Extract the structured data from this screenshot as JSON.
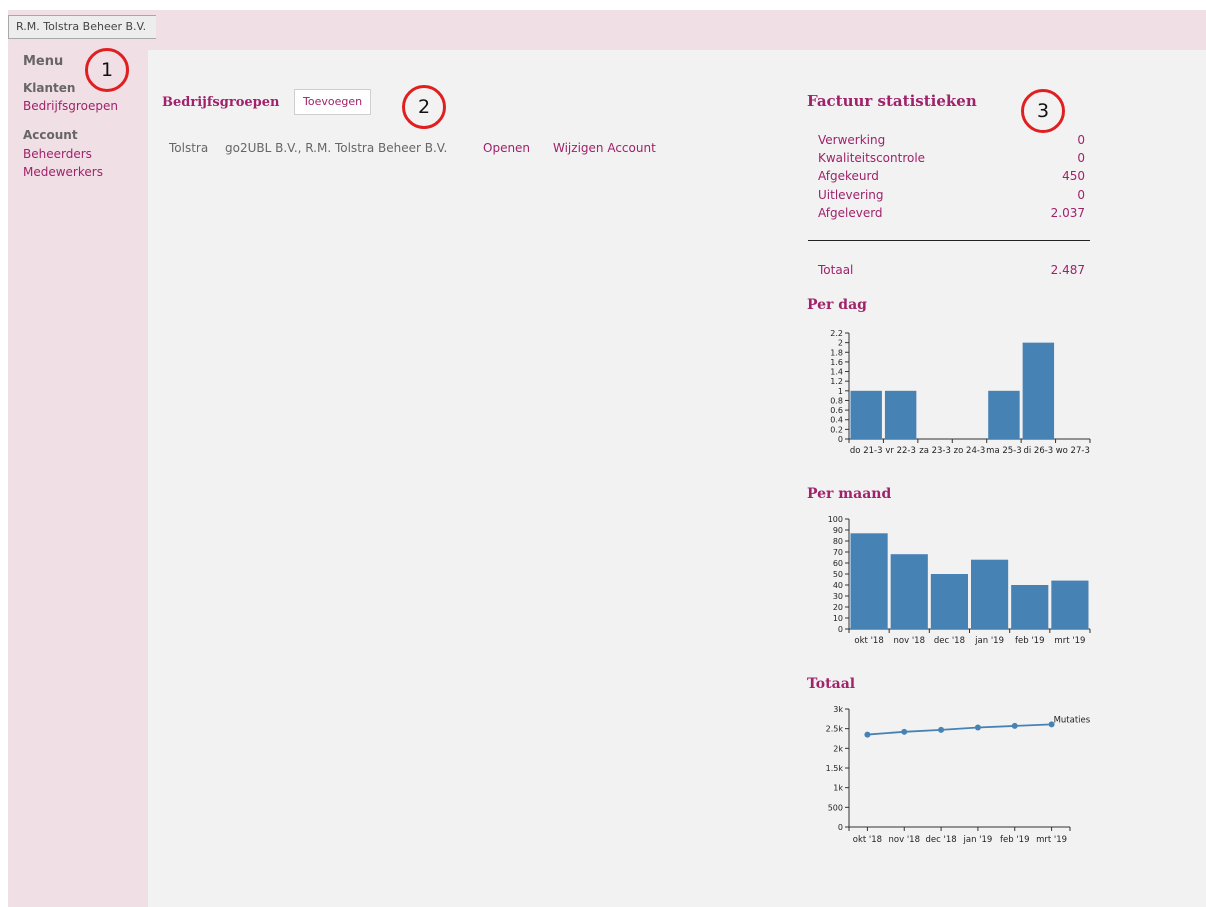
{
  "breadcrumb": {
    "label": "R.M. Tolstra Beheer B.V."
  },
  "sidebar": {
    "menu_label": "Menu",
    "groups": [
      {
        "heading": "Klanten",
        "items": [
          "Bedrijfsgroepen"
        ]
      },
      {
        "heading": "Account",
        "items": [
          "Beheerders",
          "Medewerkers"
        ]
      }
    ]
  },
  "annotations": [
    "1",
    "2",
    "3"
  ],
  "groups_section": {
    "title": "Bedrijfsgroepen",
    "add_button": "Toevoegen",
    "rows": [
      {
        "name": "Tolstra",
        "companies": "go2UBL B.V., R.M. Tolstra Beheer B.V.",
        "open": "Openen",
        "edit": "Wijzigen Account"
      }
    ]
  },
  "stats": {
    "title": "Factuur statistieken",
    "rows": [
      {
        "label": "Verwerking",
        "value": "0"
      },
      {
        "label": "Kwaliteitscontrole",
        "value": "0"
      },
      {
        "label": "Afgekeurd",
        "value": "450"
      },
      {
        "label": "Uitlevering",
        "value": "0"
      },
      {
        "label": "Afgeleverd",
        "value": "2.037"
      }
    ],
    "total_label": "Totaal",
    "total_value": "2.487"
  },
  "colors": {
    "accent": "#a0226a",
    "bar": "#4682b4",
    "sidebar_bg": "#f1dfe6",
    "main_bg": "#f2f2f2"
  },
  "chart_data": [
    {
      "type": "bar",
      "title": "Per dag",
      "categories": [
        "do 21-3",
        "vr 22-3",
        "za 23-3",
        "zo 24-3",
        "ma 25-3",
        "di 26-3",
        "wo 27-3"
      ],
      "values": [
        1,
        1,
        0,
        0,
        1,
        2,
        0
      ],
      "yticks": [
        "0",
        "0.2",
        "0.4",
        "0.6",
        "0.8",
        "1",
        "1.2",
        "1.4",
        "1.6",
        "1.8",
        "2",
        "2.2"
      ],
      "ylim": [
        0,
        2.2
      ]
    },
    {
      "type": "bar",
      "title": "Per maand",
      "categories": [
        "okt '18",
        "nov '18",
        "dec '18",
        "jan '19",
        "feb '19",
        "mrt '19"
      ],
      "values": [
        87,
        68,
        50,
        63,
        40,
        44
      ],
      "yticks": [
        "0",
        "10",
        "20",
        "30",
        "40",
        "50",
        "60",
        "70",
        "80",
        "90",
        "100"
      ],
      "ylim": [
        0,
        100
      ]
    },
    {
      "type": "line",
      "title": "Totaal",
      "categories": [
        "okt '18",
        "nov '18",
        "dec '18",
        "jan '19",
        "feb '19",
        "mrt '19"
      ],
      "series": [
        {
          "name": "Mutaties",
          "values": [
            2350,
            2420,
            2470,
            2530,
            2570,
            2610
          ]
        }
      ],
      "yticks": [
        "0",
        "500",
        "1k",
        "1.5k",
        "2k",
        "2.5k",
        "3k"
      ],
      "ylim": [
        0,
        3000
      ]
    }
  ]
}
